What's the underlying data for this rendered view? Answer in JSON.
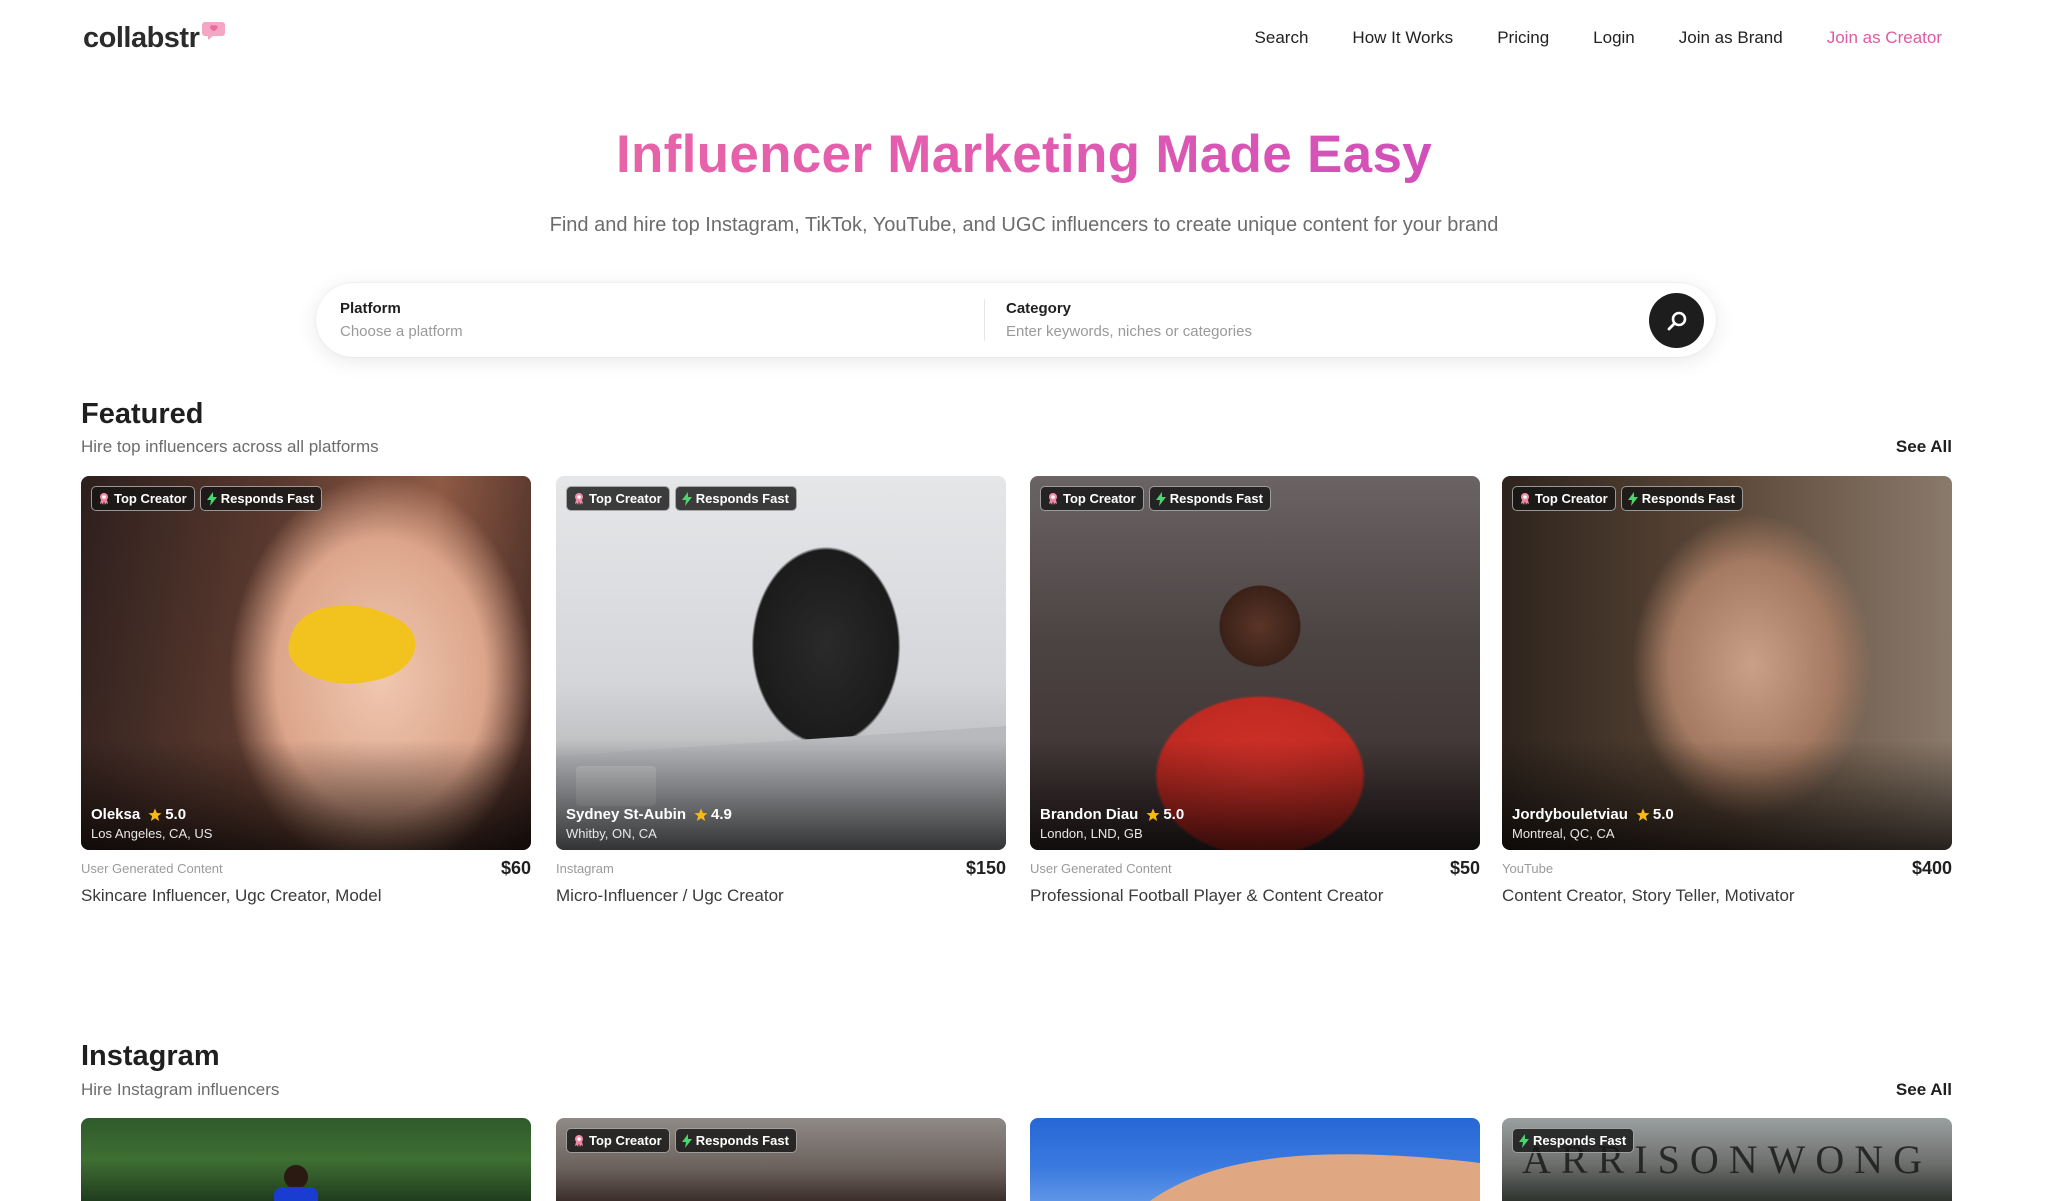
{
  "brand": {
    "name": "collabstr"
  },
  "nav": {
    "links": [
      "Search",
      "How It Works",
      "Pricing",
      "Login",
      "Join as Brand",
      "Join as Creator"
    ]
  },
  "hero": {
    "title": "Influencer Marketing Made Easy",
    "subtitle": "Find and hire top Instagram, TikTok, YouTube, and UGC influencers to create unique content for your brand"
  },
  "search": {
    "platform_label": "Platform",
    "platform_placeholder": "Choose a platform",
    "category_label": "Category",
    "category_placeholder": "Enter keywords, niches or categories"
  },
  "badges": {
    "top_creator": "Top Creator",
    "responds_fast": "Responds Fast"
  },
  "featured": {
    "title": "Featured",
    "subtitle": "Hire top influencers across all platforms",
    "see_all": "See All",
    "cards": [
      {
        "name": "Oleksa",
        "rating": "5.0",
        "location": "Los Angeles, CA, US",
        "category": "User Generated Content",
        "price": "$60",
        "title": "Skincare Influencer, Ugc Creator, Model"
      },
      {
        "name": "Sydney St-Aubin",
        "rating": "4.9",
        "location": "Whitby, ON, CA",
        "category": "Instagram",
        "price": "$150",
        "title": "Micro-Influencer / Ugc Creator"
      },
      {
        "name": "Brandon Diau",
        "rating": "5.0",
        "location": "London, LND, GB",
        "category": "User Generated Content",
        "price": "$50",
        "title": "Professional Football Player & Content Creator"
      },
      {
        "name": "Jordybouletviau",
        "rating": "5.0",
        "location": "Montreal, QC, CA",
        "category": "YouTube",
        "price": "$400",
        "title": "Content Creator, Story Teller, Motivator"
      }
    ]
  },
  "instagram": {
    "title": "Instagram",
    "subtitle": "Hire Instagram influencers",
    "see_all": "See All",
    "card4_overlay_text": "ARRISONWONG"
  },
  "colors": {
    "accent": "#e05aa2",
    "gradient_start": "#f06e9b",
    "gradient_end": "#b53bc9",
    "badge_bg": "#161616",
    "star": "#f6b916"
  },
  "icons": [
    "logo-heart-icon",
    "search-icon",
    "award-icon",
    "bolt-icon",
    "star-icon"
  ]
}
